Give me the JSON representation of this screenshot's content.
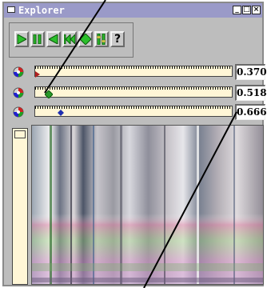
{
  "window": {
    "title": "Explorer",
    "minimize_label": "_",
    "maximize_label": "□",
    "close_label": "×"
  },
  "toolbar": {
    "buttons": [
      {
        "name": "play-button",
        "icon": "play-icon"
      },
      {
        "name": "pause-button",
        "icon": "pause-icon"
      },
      {
        "name": "reverse-button",
        "icon": "reverse-icon"
      },
      {
        "name": "rewind-button",
        "icon": "rewind-icon"
      },
      {
        "name": "bounce-button",
        "icon": "bounce-icon"
      },
      {
        "name": "settings-button",
        "icon": "settings-icon"
      },
      {
        "name": "help-button",
        "label": "?",
        "icon": "help-icon"
      }
    ]
  },
  "sliders": [
    {
      "value": "0.370",
      "marker_color": "#b02020",
      "marker_shape": "triangle"
    },
    {
      "value": "0.518",
      "marker_color": "#2a9a2a",
      "marker_shape": "diamond"
    },
    {
      "value": "0.666",
      "marker_color": "#1f2fb0",
      "marker_shape": "diamond"
    }
  ],
  "colors": {
    "titlebar": "#9a9ac8",
    "track": "#fff6d6",
    "accent_green": "#2bbf2b"
  }
}
